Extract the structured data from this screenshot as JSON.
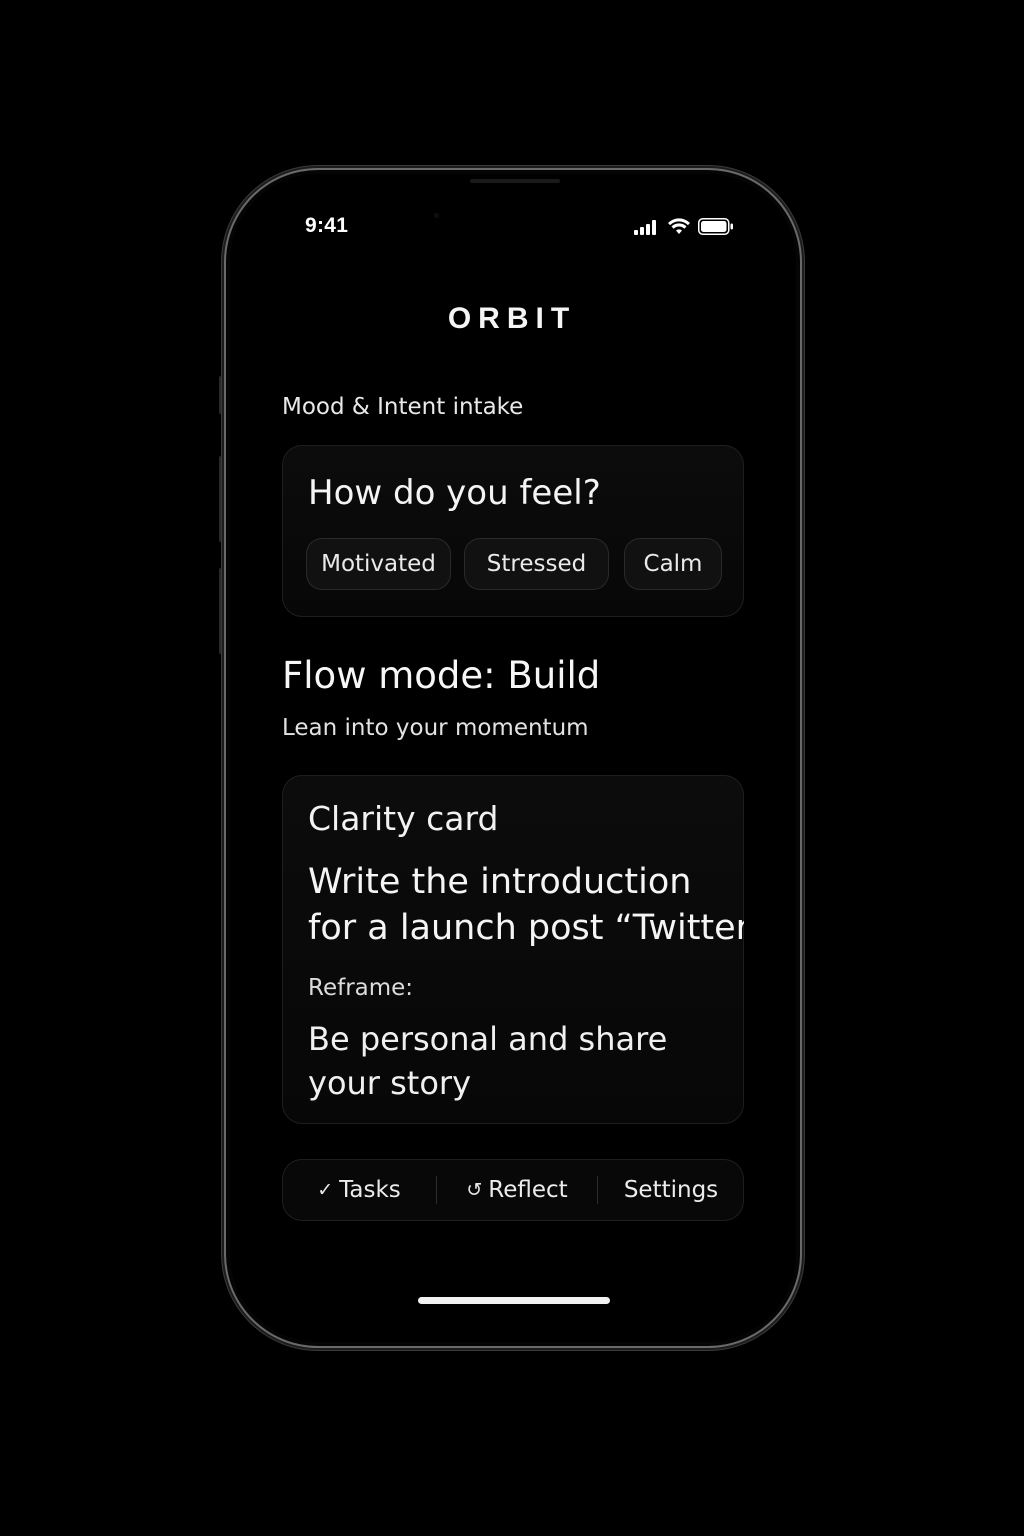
{
  "status_bar": {
    "time": "9:41",
    "icons": [
      "signal-icon",
      "wifi-icon",
      "battery-icon"
    ]
  },
  "app": {
    "brand": "ORBIT"
  },
  "mood_section": {
    "label": "Mood & Intent intake",
    "question": "How do you feel?",
    "options": [
      "Motivated",
      "Stressed",
      "Calm"
    ]
  },
  "flow": {
    "title": "Flow mode: Build",
    "subtitle": "Lean into your momentum"
  },
  "clarity_card": {
    "title": "Clarity card",
    "task_line_1": "Write the introduction",
    "task_line_2": "for a launch post “Twitter",
    "reframe_label": "Reframe:",
    "reframe_text": "Be personal and share your story"
  },
  "tab_bar": {
    "tabs": [
      {
        "icon": "check-icon",
        "glyph": "✓",
        "label": "Tasks"
      },
      {
        "icon": "undo-icon",
        "glyph": "↺",
        "label": "Reflect"
      },
      {
        "icon": "",
        "glyph": "",
        "label": "Settings"
      }
    ]
  },
  "colors": {
    "background": "#000000",
    "card": "#0b0b0b",
    "text": "#f2f2f2",
    "chip": "#111111"
  }
}
